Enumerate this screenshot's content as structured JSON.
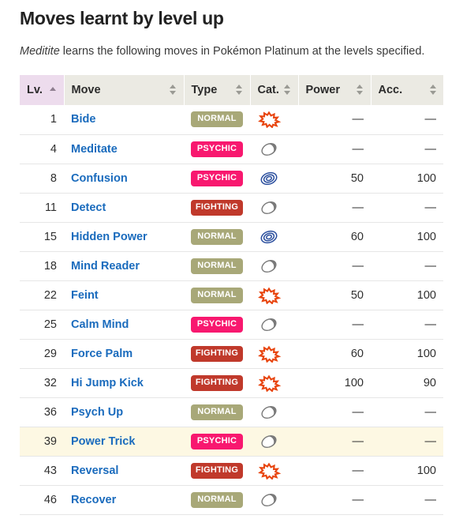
{
  "page": {
    "title": "Moves learnt by level up",
    "intro_species": "Meditite",
    "intro_rest": " learns the following moves in Pokémon Platinum at the levels specified."
  },
  "colors": {
    "link": "#1a6bbd",
    "header_bg": "#ebeae3",
    "sorted_header_bg": "#eddced",
    "highlight_row_bg": "#fdf8e3",
    "type_normal": "#a8a878",
    "type_psychic": "#f8186f",
    "type_fighting": "#c0392b",
    "cat_physical": "#e8450f",
    "cat_special": "#2b4f9e",
    "cat_status": "#7a7a7a"
  },
  "table": {
    "columns": [
      {
        "key": "lv",
        "label": "Lv.",
        "sort": "asc",
        "sorted": true
      },
      {
        "key": "move",
        "label": "Move",
        "sort": "none",
        "sorted": false
      },
      {
        "key": "type",
        "label": "Type",
        "sort": "none",
        "sorted": false
      },
      {
        "key": "cat",
        "label": "Cat.",
        "sort": "none",
        "sorted": false
      },
      {
        "key": "power",
        "label": "Power",
        "sort": "none",
        "sorted": false
      },
      {
        "key": "acc",
        "label": "Acc.",
        "sort": "none",
        "sorted": false
      }
    ],
    "rows": [
      {
        "lv": "1",
        "move": "Bide",
        "type": "Normal",
        "type_class": "type-normal",
        "cat": "physical",
        "cat_label": "Physical",
        "power": "—",
        "acc": "—",
        "highlight": false
      },
      {
        "lv": "4",
        "move": "Meditate",
        "type": "Psychic",
        "type_class": "type-psychic",
        "cat": "status",
        "cat_label": "Status",
        "power": "—",
        "acc": "—",
        "highlight": false
      },
      {
        "lv": "8",
        "move": "Confusion",
        "type": "Psychic",
        "type_class": "type-psychic",
        "cat": "special",
        "cat_label": "Special",
        "power": "50",
        "acc": "100",
        "highlight": false
      },
      {
        "lv": "11",
        "move": "Detect",
        "type": "Fighting",
        "type_class": "type-fighting",
        "cat": "status",
        "cat_label": "Status",
        "power": "—",
        "acc": "—",
        "highlight": false
      },
      {
        "lv": "15",
        "move": "Hidden Power",
        "type": "Normal",
        "type_class": "type-normal",
        "cat": "special",
        "cat_label": "Special",
        "power": "60",
        "acc": "100",
        "highlight": false
      },
      {
        "lv": "18",
        "move": "Mind Reader",
        "type": "Normal",
        "type_class": "type-normal",
        "cat": "status",
        "cat_label": "Status",
        "power": "—",
        "acc": "—",
        "highlight": false
      },
      {
        "lv": "22",
        "move": "Feint",
        "type": "Normal",
        "type_class": "type-normal",
        "cat": "physical",
        "cat_label": "Physical",
        "power": "50",
        "acc": "100",
        "highlight": false
      },
      {
        "lv": "25",
        "move": "Calm Mind",
        "type": "Psychic",
        "type_class": "type-psychic",
        "cat": "status",
        "cat_label": "Status",
        "power": "—",
        "acc": "—",
        "highlight": false
      },
      {
        "lv": "29",
        "move": "Force Palm",
        "type": "Fighting",
        "type_class": "type-fighting",
        "cat": "physical",
        "cat_label": "Physical",
        "power": "60",
        "acc": "100",
        "highlight": false
      },
      {
        "lv": "32",
        "move": "Hi Jump Kick",
        "type": "Fighting",
        "type_class": "type-fighting",
        "cat": "physical",
        "cat_label": "Physical",
        "power": "100",
        "acc": "90",
        "highlight": false
      },
      {
        "lv": "36",
        "move": "Psych Up",
        "type": "Normal",
        "type_class": "type-normal",
        "cat": "status",
        "cat_label": "Status",
        "power": "—",
        "acc": "—",
        "highlight": false
      },
      {
        "lv": "39",
        "move": "Power Trick",
        "type": "Psychic",
        "type_class": "type-psychic",
        "cat": "status",
        "cat_label": "Status",
        "power": "—",
        "acc": "—",
        "highlight": true
      },
      {
        "lv": "43",
        "move": "Reversal",
        "type": "Fighting",
        "type_class": "type-fighting",
        "cat": "physical",
        "cat_label": "Physical",
        "power": "—",
        "acc": "100",
        "highlight": false
      },
      {
        "lv": "46",
        "move": "Recover",
        "type": "Normal",
        "type_class": "type-normal",
        "cat": "status",
        "cat_label": "Status",
        "power": "—",
        "acc": "—",
        "highlight": false
      }
    ]
  }
}
